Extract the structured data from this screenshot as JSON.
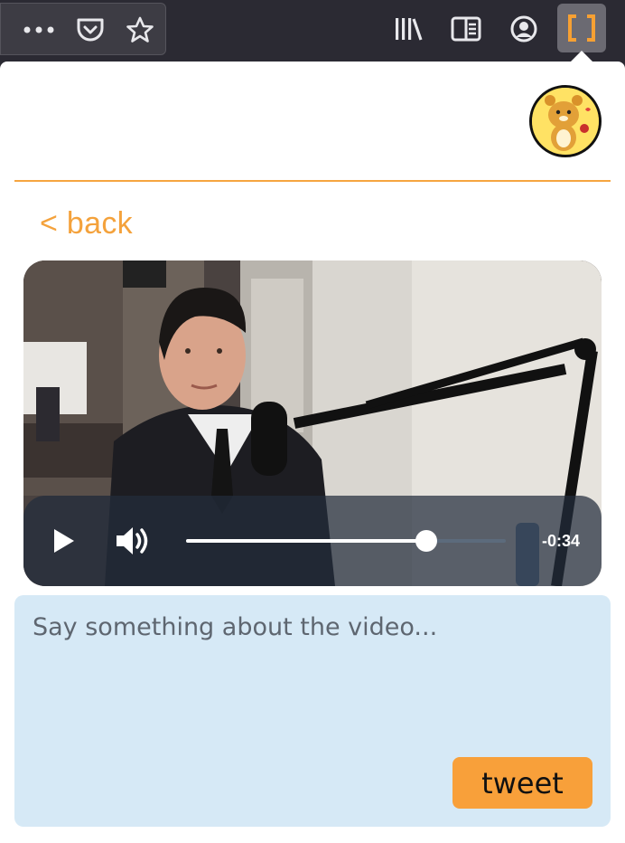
{
  "browser": {
    "icons": [
      "more-icon",
      "pocket-icon",
      "bookmark-star-icon",
      "library-icon",
      "reader-view-icon",
      "account-icon",
      "extension-icon"
    ]
  },
  "popup": {
    "back_label": "< back",
    "video": {
      "time_remaining": "-0:34",
      "progress": 0.75
    },
    "compose": {
      "placeholder": "Say something about the video...",
      "value": ""
    },
    "tweet_label": "tweet"
  },
  "colors": {
    "accent": "#f4a23c",
    "compose_bg": "#d6e9f6",
    "toolbar_bg": "#2b2a33"
  }
}
